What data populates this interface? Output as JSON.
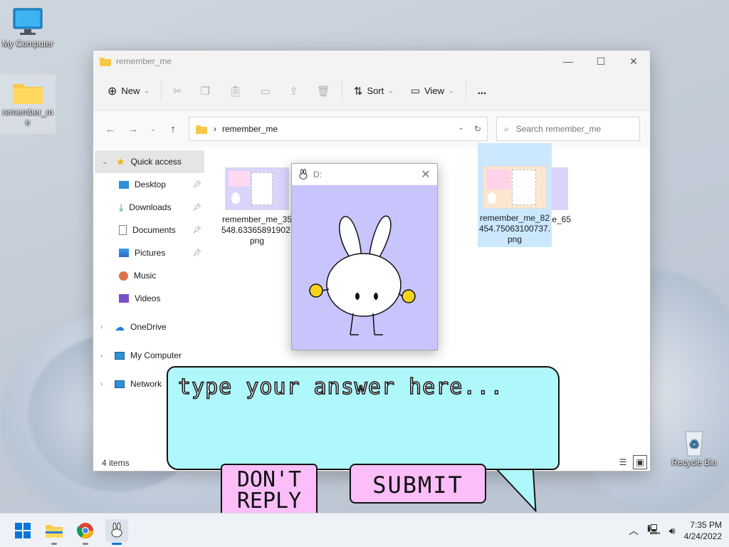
{
  "desktop": {
    "icons": [
      {
        "label": "My Computer"
      },
      {
        "label": "remember_me"
      },
      {
        "label": "Recycle Bin"
      }
    ]
  },
  "explorer": {
    "title": "remember_me",
    "commands": {
      "new_label": "New",
      "sort_label": "Sort",
      "view_label": "View",
      "more_label": "..."
    },
    "address": {
      "path": "remember_me"
    },
    "search": {
      "placeholder": "Search remember_me"
    },
    "sidebar": [
      {
        "label": "Quick access"
      },
      {
        "label": "Desktop"
      },
      {
        "label": "Downloads"
      },
      {
        "label": "Documents"
      },
      {
        "label": "Pictures"
      },
      {
        "label": "Music"
      },
      {
        "label": "Videos"
      },
      {
        "label": "OneDrive"
      },
      {
        "label": "My Computer"
      },
      {
        "label": "Network"
      }
    ],
    "files": [
      {
        "name": "remember_me_35548.63365891902.png"
      },
      {
        "name": "remember_me_6​56359"
      },
      {
        "name": "remember_me_82454.75063100737.png"
      }
    ],
    "status": "4 items"
  },
  "popup": {
    "title": "D:"
  },
  "dialog": {
    "prompt": "type your answer here...",
    "dont_reply_label": "DON'T REPLY",
    "submit_label": "SUBMIT"
  },
  "taskbar": {
    "time": "7:35 PM",
    "date": "4/24/2022"
  },
  "colors": {
    "bubble": "#aef7fb",
    "button_pink": "#fbbef9",
    "popup_bg": "#c7c5fb",
    "selection": "#cce8ff"
  }
}
